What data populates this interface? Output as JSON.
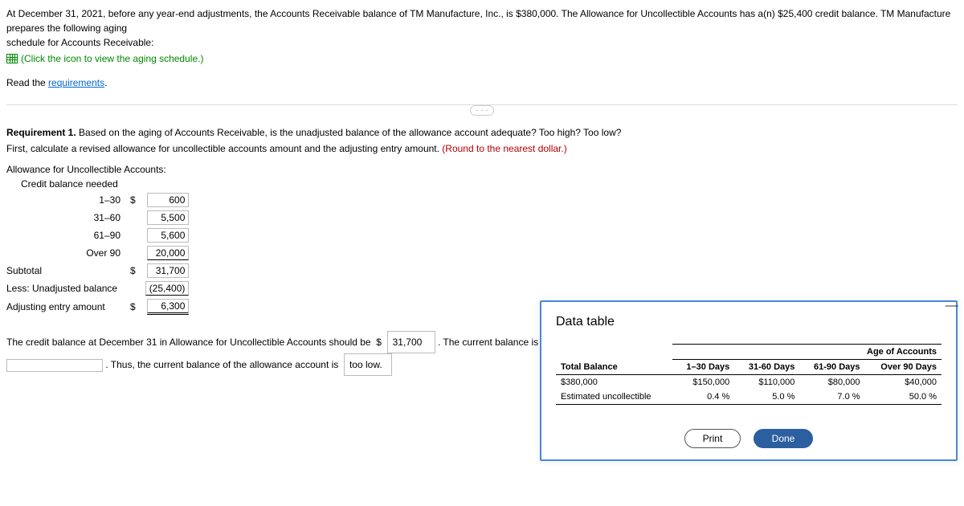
{
  "intro": {
    "line1_a": "At December 31, 2021, before any year-end adjustments, the Accounts Receivable balance of TM Manufacture, Inc., is $380,000. The Allowance for Uncollectible Accounts has a(n) $25,400 credit balance. TM Manufacture prepares the following aging",
    "line1_b": "schedule for Accounts Receivable:",
    "view_link": "(Click the icon to view the aging schedule.)",
    "read_prefix": "Read the ",
    "requirements_link": "requirements"
  },
  "requirement": {
    "label": "Requirement 1.",
    "text": " Based on the aging of Accounts Receivable, is the unadjusted balance of the allowance account adequate? Too high? Too low?",
    "instruct": "First, calculate a revised allowance for uncollectible accounts amount and the adjusting entry amount. ",
    "round_hint": "(Round to the nearest dollar.)"
  },
  "calc": {
    "heading": "Allowance for Uncollectible Accounts:",
    "sub_heading": "Credit balance needed",
    "rows": [
      {
        "label": "1–30",
        "cur": "$",
        "val": "600"
      },
      {
        "label": "31–60",
        "cur": "",
        "val": "5,500"
      },
      {
        "label": "61–90",
        "cur": "",
        "val": "5,600"
      },
      {
        "label": "Over 90",
        "cur": "",
        "val": "20,000"
      }
    ],
    "subtotal_label": "Subtotal",
    "subtotal_cur": "$",
    "subtotal_val": "31,700",
    "less_label": "Less: Unadjusted balance",
    "less_val": "(25,400)",
    "adj_label": "Adjusting entry amount",
    "adj_cur": "$",
    "adj_val": "6,300"
  },
  "sentence": {
    "s1": "The credit balance at December 31 in Allowance for Uncollectible Accounts should be",
    "s1_cur": "$",
    "s1_val": "31,700",
    "s1_after": " . The current balance is",
    "s2_after_blank": ". Thus, the current balance of the allowance account is",
    "s2_dropdown": "too low.",
    "period": ""
  },
  "popup": {
    "title": "Data table",
    "age_header": "Age of Accounts",
    "cols": [
      "Total Balance",
      "1–30 Days",
      "31-60 Days",
      "61-90 Days",
      "Over 90 Days"
    ],
    "row_balance": [
      "$380,000",
      "$150,000",
      "$110,000",
      "$80,000",
      "$40,000"
    ],
    "row_pct_label": "Estimated uncollectible",
    "row_pct": [
      "0.4 %",
      "5.0 %",
      "7.0 %",
      "50.0 %"
    ],
    "print": "Print",
    "done": "Done"
  },
  "chart_data": {
    "type": "table",
    "title": "Age of Accounts",
    "columns": [
      "Total Balance",
      "1–30 Days",
      "31-60 Days",
      "61-90 Days",
      "Over 90 Days"
    ],
    "rows": [
      {
        "label": "Balance",
        "values": [
          380000,
          150000,
          110000,
          80000,
          40000
        ]
      },
      {
        "label": "Estimated uncollectible %",
        "values": [
          null,
          0.4,
          5.0,
          7.0,
          50.0
        ]
      }
    ]
  }
}
